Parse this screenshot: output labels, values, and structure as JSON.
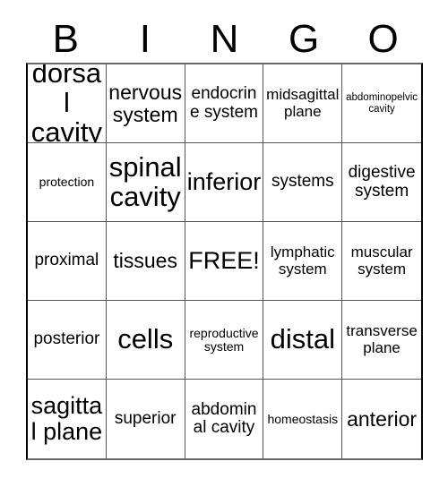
{
  "header": {
    "letters": [
      "B",
      "I",
      "N",
      "G",
      "O"
    ]
  },
  "grid": {
    "rows": 5,
    "columns": 5,
    "cells": [
      [
        {
          "label": "dorsal cavity",
          "size": "xxl"
        },
        {
          "label": "nervous system",
          "size": "lg"
        },
        {
          "label": "endocrine system",
          "size": "md"
        },
        {
          "label": "midsagittal plane",
          "size": "sm"
        },
        {
          "label": "abdominopelvic cavity",
          "size": "xxs"
        }
      ],
      [
        {
          "label": "protection",
          "size": "xs"
        },
        {
          "label": "spinal cavity",
          "size": "xxl"
        },
        {
          "label": "inferior",
          "size": "xl"
        },
        {
          "label": "systems",
          "size": "md"
        },
        {
          "label": "digestive system",
          "size": "md"
        }
      ],
      [
        {
          "label": "proximal",
          "size": "md"
        },
        {
          "label": "tissues",
          "size": "lg"
        },
        {
          "label": "FREE!",
          "size": "xl"
        },
        {
          "label": "lymphatic system",
          "size": "sm"
        },
        {
          "label": "muscular system",
          "size": "sm"
        }
      ],
      [
        {
          "label": "posterior",
          "size": "md"
        },
        {
          "label": "cells",
          "size": "xxl"
        },
        {
          "label": "reproductive system",
          "size": "xs"
        },
        {
          "label": "distal",
          "size": "xxl"
        },
        {
          "label": "transverse plane",
          "size": "sm"
        }
      ],
      [
        {
          "label": "sagittal plane",
          "size": "xl"
        },
        {
          "label": "superior",
          "size": "md"
        },
        {
          "label": "abdominal cavity",
          "size": "md"
        },
        {
          "label": "homeostasis",
          "size": "xs"
        },
        {
          "label": "anterior",
          "size": "lg"
        }
      ]
    ]
  },
  "colors": {
    "background": "#ffffff",
    "text": "#000000",
    "grid_line": "#555555",
    "border": "#000000"
  }
}
